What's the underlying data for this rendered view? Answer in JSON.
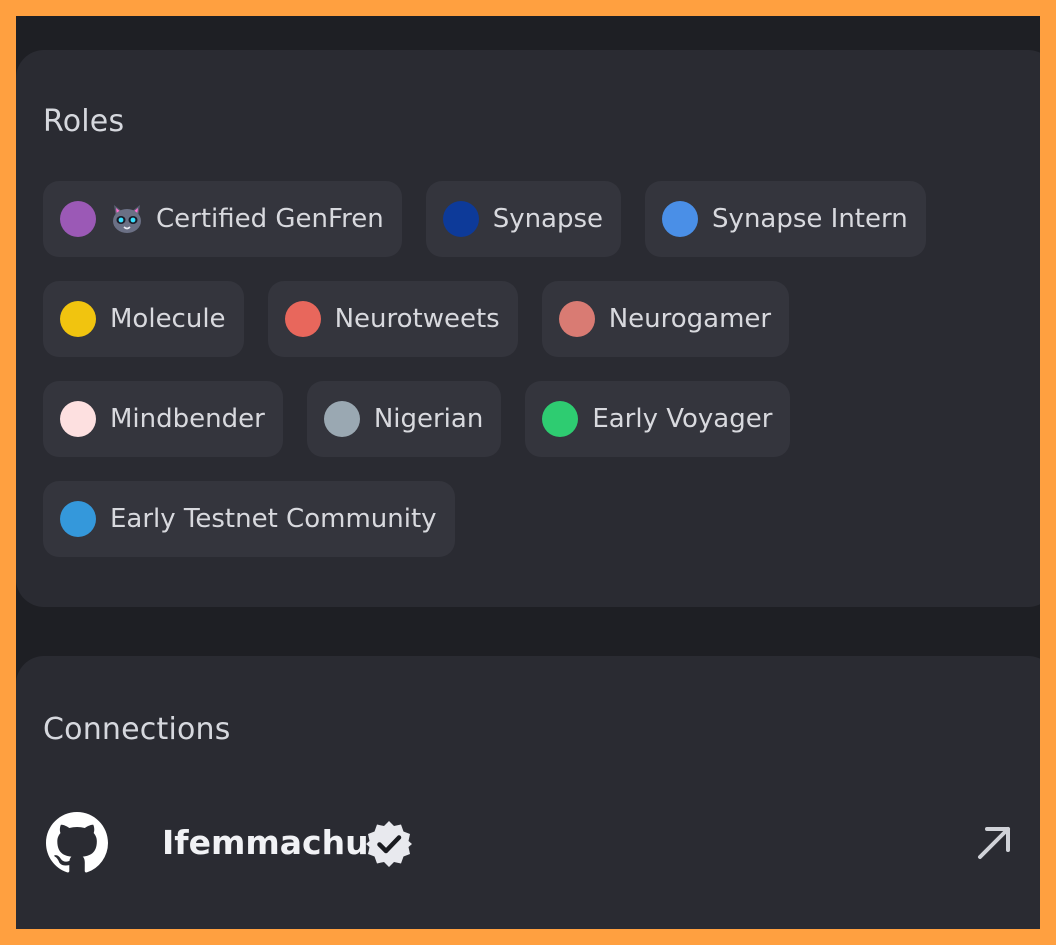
{
  "roles": {
    "title": "Roles",
    "rows": [
      [
        {
          "label": "Certified GenFren",
          "color": "#9b59b6",
          "emoji": "cat-face-icon"
        },
        {
          "label": "Synapse",
          "color": "#0d3a99"
        },
        {
          "label": "Synapse Intern",
          "color": "#4a8fe7"
        }
      ],
      [
        {
          "label": "Molecule",
          "color": "#f1c40f"
        },
        {
          "label": "Neurotweets",
          "color": "#e8675c"
        },
        {
          "label": "Neurogamer",
          "color": "#d97b73"
        }
      ],
      [
        {
          "label": "Mindbender",
          "color": "#fde0e0"
        },
        {
          "label": "Nigerian",
          "color": "#9aa8b2"
        },
        {
          "label": "Early Voyager",
          "color": "#2ecc71"
        }
      ],
      [
        {
          "label": "Early Testnet Community",
          "color": "#3498db"
        }
      ]
    ]
  },
  "connections": {
    "title": "Connections",
    "items": [
      {
        "name": "Ifemmachu",
        "service_icon": "github-icon",
        "verified": true
      }
    ]
  }
}
